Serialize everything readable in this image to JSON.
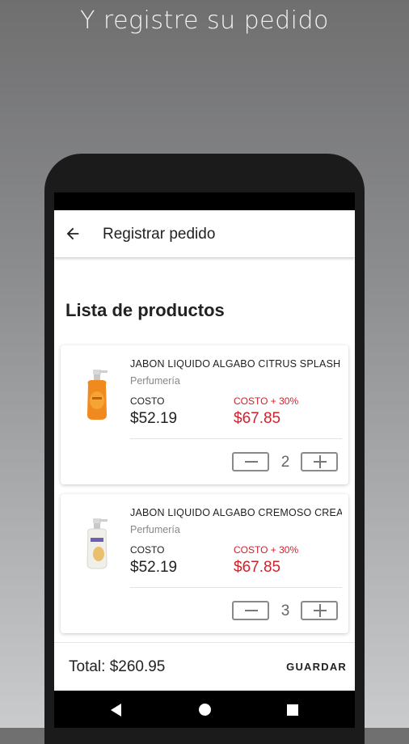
{
  "promo": {
    "title": "Y registre su pedido"
  },
  "appbar": {
    "title": "Registrar pedido",
    "back_icon": "arrow-left-icon"
  },
  "section": {
    "title": "Lista de productos"
  },
  "products": [
    {
      "name": "JABON LIQUIDO ALGABO CITRUS SPLASH",
      "category": "Perfumería",
      "cost_label": "COSTO",
      "cost": "$52.19",
      "markup_label": "COSTO + 30%",
      "markup_cost": "$67.85",
      "quantity": "2",
      "image_icon": "orange-soap-bottle-icon"
    },
    {
      "name": "JABON LIQUIDO ALGABO CREMOSO CREAM",
      "category": "Perfumería",
      "cost_label": "COSTO",
      "cost": "$52.19",
      "markup_label": "COSTO + 30%",
      "markup_cost": "$67.85",
      "quantity": "3",
      "image_icon": "white-soap-bottle-icon"
    }
  ],
  "footer": {
    "total": "Total: $260.95",
    "save_label": "GUARDAR"
  },
  "colors": {
    "accent_red": "#d0202a",
    "text": "#222222",
    "muted": "#888888"
  }
}
